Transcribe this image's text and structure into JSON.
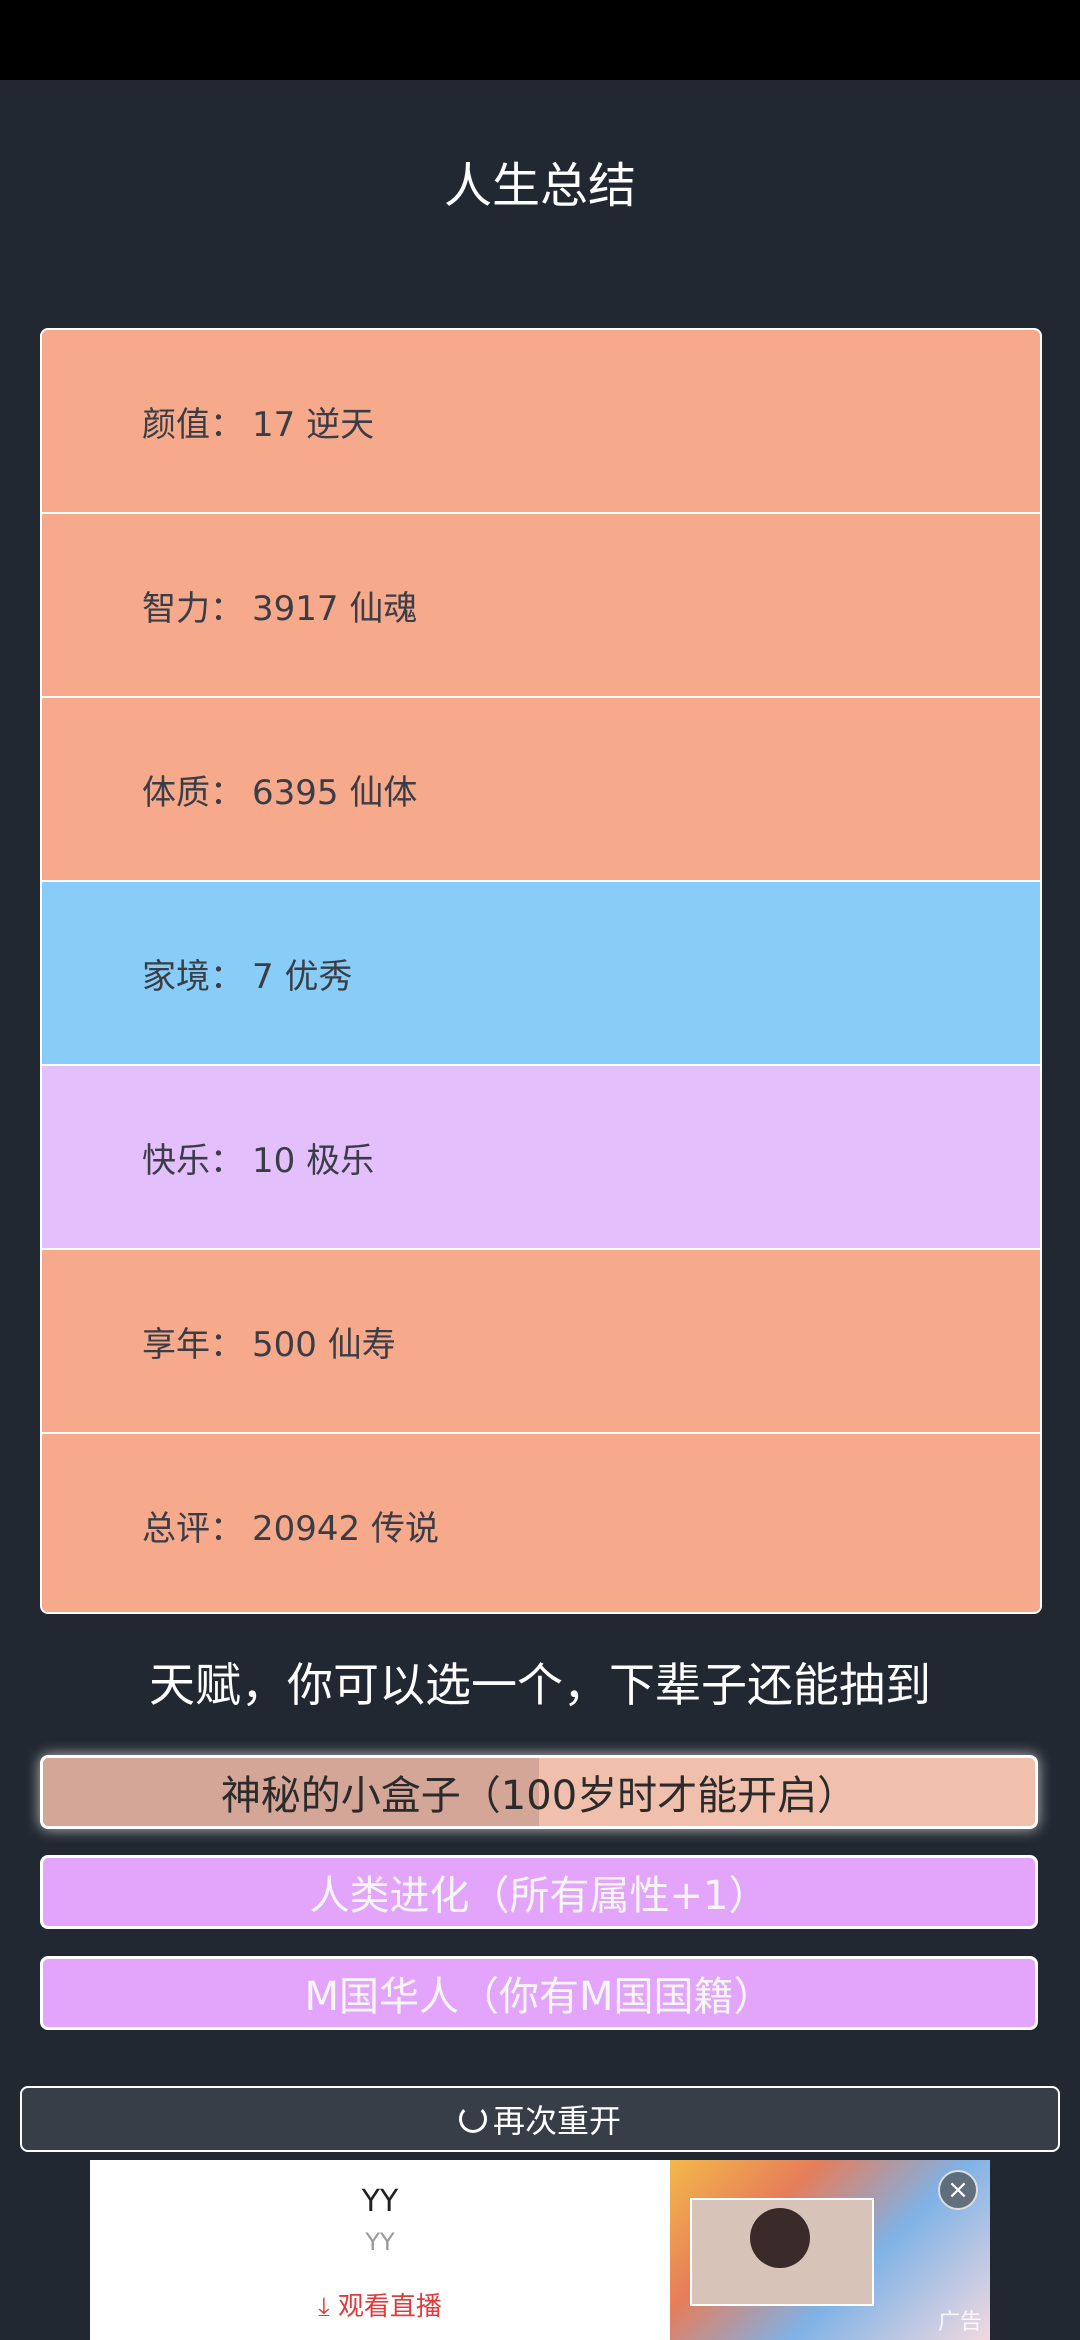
{
  "title": "人生总结",
  "summary": [
    {
      "label": "颜值",
      "sep": "：",
      "value": "17 逆天"
    },
    {
      "label": "智力",
      "sep": "：",
      "value": "3917 仙魂"
    },
    {
      "label": "体质",
      "sep": "：",
      "value": "6395 仙体"
    },
    {
      "label": "家境",
      "sep": "：",
      "value": "7 优秀"
    },
    {
      "label": "快乐",
      "sep": "：",
      "value": "10 极乐"
    },
    {
      "label": "享年",
      "sep": "：",
      "value": "500 仙寿"
    },
    {
      "label": "总评",
      "sep": "：",
      "value": "20942 传说"
    }
  ],
  "talent_heading": "天赋，你可以选一个，下辈子还能抽到",
  "talents": [
    "神秘的小盒子（100岁时才能开启）",
    "人类进化（所有属性+1）",
    "M国华人（你有M国国籍）"
  ],
  "restart_label": "再次重开",
  "ad": {
    "title": "YY",
    "subtitle": "YY",
    "cta": "观看直播",
    "tag": "广告"
  },
  "colors": {
    "background": "#222831",
    "orange": "#f6a98b",
    "blue": "#88cdf8",
    "purple": "#e3bffc",
    "talent_purple": "#e3a5fb"
  }
}
